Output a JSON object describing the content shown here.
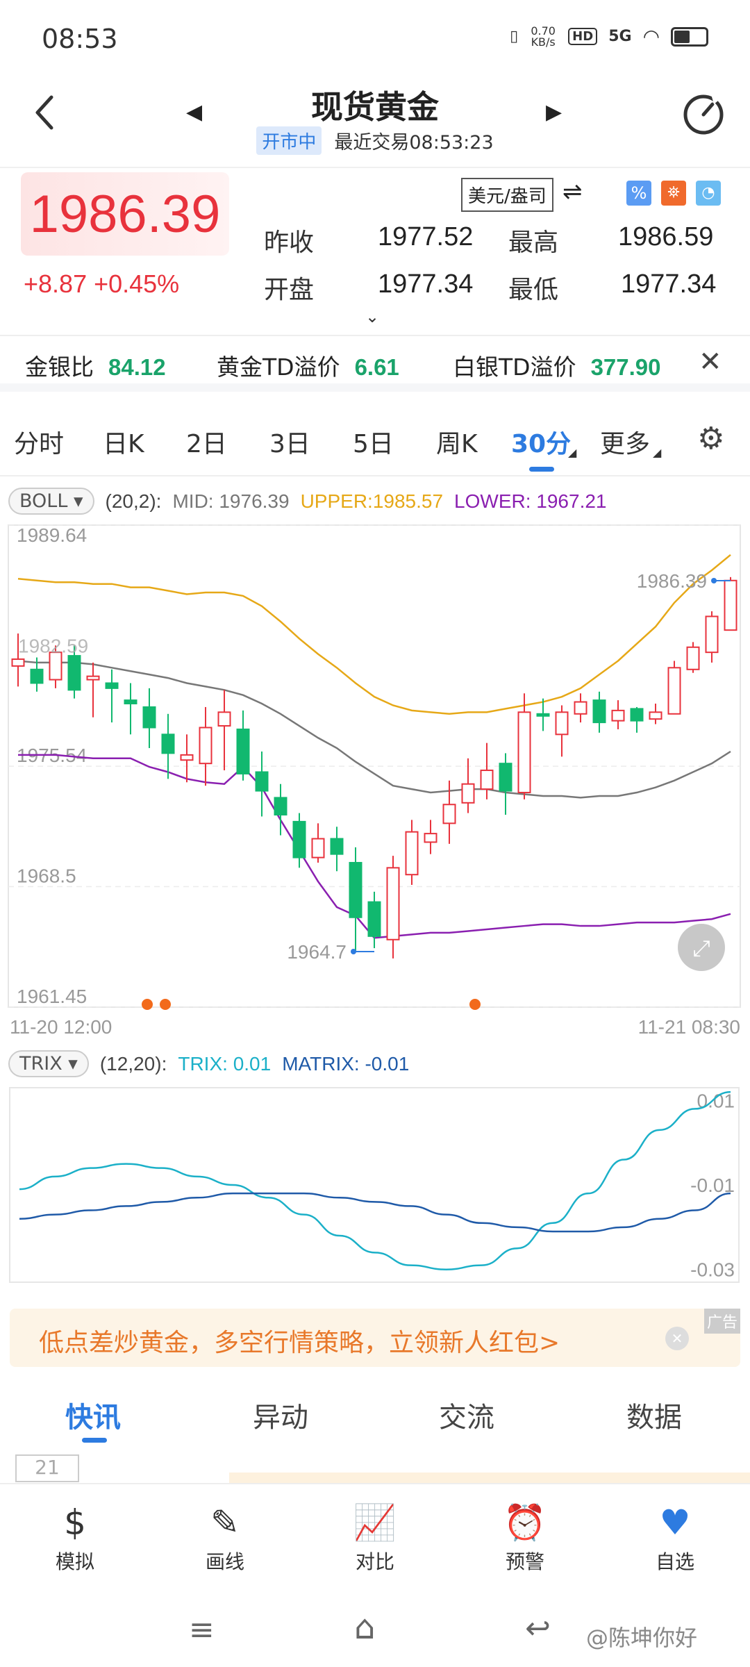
{
  "status": {
    "time": "08:53",
    "net_speed": "0.70 KB/s",
    "hd": "HD",
    "signal": "5G"
  },
  "header": {
    "title": "现货黄金",
    "market_status": "开市中",
    "last_trade": "最近交易08:53:23"
  },
  "quote": {
    "price": "1986.39",
    "change": "+8.87 +0.45%",
    "unit": "美元/盎司",
    "prev_close_label": "昨收",
    "prev_close": "1977.52",
    "high_label": "最高",
    "high": "1986.59",
    "open_label": "开盘",
    "open": "1977.34",
    "low_label": "最低",
    "low": "1977.34"
  },
  "ratios": [
    {
      "label": "金银比",
      "value": "84.12"
    },
    {
      "label": "黄金TD溢价",
      "value": "6.61"
    },
    {
      "label": "白银TD溢价",
      "value": "377.90"
    }
  ],
  "period_tabs": [
    "分时",
    "日K",
    "2日",
    "3日",
    "5日",
    "周K",
    "30分",
    "更多"
  ],
  "active_period": "30分",
  "boll": {
    "name": "BOLL",
    "params": "(20,2):",
    "mid": "MID: 1976.39",
    "upper": "UPPER:1985.57",
    "lower": "LOWER: 1967.21"
  },
  "trix": {
    "name": "TRIX",
    "params": "(12,20):",
    "trix": "TRIX: 0.01",
    "matrix": "MATRIX: -0.01"
  },
  "colors": {
    "up": "#e8323c",
    "down": "#11b86f",
    "upper": "#e6a817",
    "lower": "#8a1fb0",
    "mid": "#777777",
    "trix": "#1bb0c8",
    "matrix": "#1f5aa8",
    "accent": "#2d7be0"
  },
  "chart_data": [
    {
      "type": "candlestick",
      "y_axis_labels": [
        "1989.64",
        "1975.54",
        "1968.5",
        "1961.45"
      ],
      "ylim": [
        1961.45,
        1989.64
      ],
      "x_labels": [
        "11-20 12:00",
        "11-21 08:30"
      ],
      "annotations": {
        "max": "1986.39",
        "min": "1964.7",
        "left_overlay": "1982.59"
      },
      "candles": [
        {
          "o": 1981.4,
          "c": 1981.8,
          "h": 1983.3,
          "l": 1980.2
        },
        {
          "o": 1981.2,
          "c": 1980.4,
          "h": 1981.9,
          "l": 1979.9
        },
        {
          "o": 1980.6,
          "c": 1982.2,
          "h": 1982.6,
          "l": 1980.1
        },
        {
          "o": 1982.0,
          "c": 1980.0,
          "h": 1982.6,
          "l": 1979.5
        },
        {
          "o": 1980.6,
          "c": 1980.8,
          "h": 1981.6,
          "l": 1978.4
        },
        {
          "o": 1980.4,
          "c": 1980.1,
          "h": 1981.2,
          "l": 1978.1
        },
        {
          "o": 1979.4,
          "c": 1979.2,
          "h": 1980.4,
          "l": 1977.4
        },
        {
          "o": 1979.0,
          "c": 1977.8,
          "h": 1980.1,
          "l": 1976.6
        },
        {
          "o": 1977.4,
          "c": 1976.3,
          "h": 1978.6,
          "l": 1974.8
        },
        {
          "o": 1975.9,
          "c": 1976.2,
          "h": 1977.4,
          "l": 1974.6
        },
        {
          "o": 1975.7,
          "c": 1977.8,
          "h": 1979.0,
          "l": 1974.4
        },
        {
          "o": 1977.9,
          "c": 1978.7,
          "h": 1980.0,
          "l": 1975.3
        },
        {
          "o": 1977.7,
          "c": 1975.1,
          "h": 1978.8,
          "l": 1974.7
        },
        {
          "o": 1975.2,
          "c": 1974.1,
          "h": 1976.4,
          "l": 1972.6
        },
        {
          "o": 1973.7,
          "c": 1972.7,
          "h": 1974.5,
          "l": 1971.5
        },
        {
          "o": 1972.3,
          "c": 1970.2,
          "h": 1972.8,
          "l": 1969.6
        },
        {
          "o": 1970.2,
          "c": 1971.3,
          "h": 1972.2,
          "l": 1969.9
        },
        {
          "o": 1971.3,
          "c": 1970.4,
          "h": 1972.0,
          "l": 1969.4
        },
        {
          "o": 1969.9,
          "c": 1966.7,
          "h": 1970.8,
          "l": 1964.7
        },
        {
          "o": 1967.6,
          "c": 1965.6,
          "h": 1968.2,
          "l": 1964.9
        },
        {
          "o": 1965.4,
          "c": 1969.6,
          "h": 1970.3,
          "l": 1964.3
        },
        {
          "o": 1969.2,
          "c": 1971.7,
          "h": 1972.4,
          "l": 1968.6
        },
        {
          "o": 1971.1,
          "c": 1971.6,
          "h": 1972.4,
          "l": 1970.4
        },
        {
          "o": 1972.2,
          "c": 1973.3,
          "h": 1974.7,
          "l": 1971.0
        },
        {
          "o": 1973.4,
          "c": 1974.5,
          "h": 1976.0,
          "l": 1972.8
        },
        {
          "o": 1974.2,
          "c": 1975.3,
          "h": 1976.9,
          "l": 1973.6
        },
        {
          "o": 1975.7,
          "c": 1974.1,
          "h": 1976.3,
          "l": 1972.7
        },
        {
          "o": 1974.0,
          "c": 1978.7,
          "h": 1979.8,
          "l": 1973.6
        },
        {
          "o": 1978.6,
          "c": 1978.5,
          "h": 1979.5,
          "l": 1977.6
        },
        {
          "o": 1977.4,
          "c": 1978.7,
          "h": 1979.1,
          "l": 1976.1
        },
        {
          "o": 1978.6,
          "c": 1979.3,
          "h": 1979.8,
          "l": 1978.1
        },
        {
          "o": 1979.4,
          "c": 1978.1,
          "h": 1979.9,
          "l": 1977.5
        },
        {
          "o": 1978.2,
          "c": 1978.8,
          "h": 1979.4,
          "l": 1977.7
        },
        {
          "o": 1978.9,
          "c": 1978.2,
          "h": 1979.0,
          "l": 1977.5
        },
        {
          "o": 1978.3,
          "c": 1978.7,
          "h": 1979.2,
          "l": 1978.0
        },
        {
          "o": 1978.6,
          "c": 1981.3,
          "h": 1981.7,
          "l": 1978.6
        },
        {
          "o": 1981.2,
          "c": 1982.5,
          "h": 1982.8,
          "l": 1981.0
        },
        {
          "o": 1982.2,
          "c": 1984.3,
          "h": 1984.6,
          "l": 1981.6
        },
        {
          "o": 1983.5,
          "c": 1986.4,
          "h": 1986.6,
          "l": 1983.5
        }
      ],
      "series": [
        {
          "name": "UPPER",
          "values": [
            1986.5,
            1986.4,
            1986.3,
            1986.3,
            1986.2,
            1986.2,
            1986.0,
            1986.0,
            1985.8,
            1985.6,
            1985.7,
            1985.7,
            1985.5,
            1984.9,
            1984.0,
            1983.0,
            1982.1,
            1981.3,
            1980.4,
            1979.6,
            1979.1,
            1978.8,
            1978.7,
            1978.6,
            1978.7,
            1978.7,
            1978.9,
            1979.1,
            1979.3,
            1979.6,
            1980.1,
            1980.9,
            1981.7,
            1982.7,
            1983.7,
            1985.1,
            1986.2,
            1987.0,
            1987.9
          ]
        },
        {
          "name": "MID",
          "values": [
            1981.7,
            1981.6,
            1981.6,
            1981.6,
            1981.5,
            1981.3,
            1981.1,
            1980.9,
            1980.7,
            1980.4,
            1980.2,
            1980.0,
            1979.7,
            1979.2,
            1978.6,
            1977.9,
            1977.2,
            1976.6,
            1975.8,
            1975.1,
            1974.4,
            1974.2,
            1974.0,
            1974.1,
            1974.2,
            1974.2,
            1974.0,
            1973.9,
            1973.8,
            1973.8,
            1973.7,
            1973.8,
            1973.8,
            1974.0,
            1974.3,
            1974.7,
            1975.2,
            1975.7,
            1976.4
          ]
        },
        {
          "name": "LOWER",
          "values": [
            1976.2,
            1976.2,
            1976.2,
            1976.1,
            1976.0,
            1976.0,
            1976.0,
            1975.5,
            1975.2,
            1974.8,
            1974.6,
            1974.5,
            1975.5,
            1974.3,
            1972.4,
            1970.6,
            1968.8,
            1967.3,
            1966.8,
            1965.5,
            1965.6,
            1965.7,
            1965.8,
            1965.8,
            1965.9,
            1966.0,
            1966.1,
            1966.2,
            1966.3,
            1966.3,
            1966.2,
            1966.2,
            1966.3,
            1966.4,
            1966.4,
            1966.4,
            1966.5,
            1966.6,
            1966.9
          ]
        }
      ]
    },
    {
      "type": "line",
      "y_axis_labels": [
        "0.01",
        "-0.01",
        "-0.03"
      ],
      "ylim": [
        -0.033,
        0.013
      ],
      "series": [
        {
          "name": "TRIX",
          "values": [
            -0.011,
            -0.008,
            -0.006,
            -0.005,
            -0.006,
            -0.008,
            -0.01,
            -0.013,
            -0.017,
            -0.022,
            -0.026,
            -0.029,
            -0.03,
            -0.029,
            -0.025,
            -0.019,
            -0.012,
            -0.004,
            0.003,
            0.008,
            0.012
          ]
        },
        {
          "name": "MATRIX",
          "values": [
            -0.018,
            -0.017,
            -0.016,
            -0.015,
            -0.014,
            -0.013,
            -0.012,
            -0.012,
            -0.012,
            -0.013,
            -0.014,
            -0.015,
            -0.017,
            -0.019,
            -0.02,
            -0.021,
            -0.021,
            -0.02,
            -0.018,
            -0.016,
            -0.012
          ]
        }
      ]
    }
  ],
  "promo": {
    "text": "低点差炒黄金，多空行情策略，立领新人红包>",
    "ad": "广告"
  },
  "feed_tabs": [
    "快讯",
    "异动",
    "交流",
    "数据"
  ],
  "feed_date": "21",
  "bottom_nav": [
    {
      "label": "模拟",
      "icon": "simulate-icon"
    },
    {
      "label": "画线",
      "icon": "draw-line-icon"
    },
    {
      "label": "对比",
      "icon": "compare-icon"
    },
    {
      "label": "预警",
      "icon": "alert-icon"
    },
    {
      "label": "自选",
      "icon": "favorite-heart-icon"
    }
  ],
  "watermark": "@陈坤你好"
}
